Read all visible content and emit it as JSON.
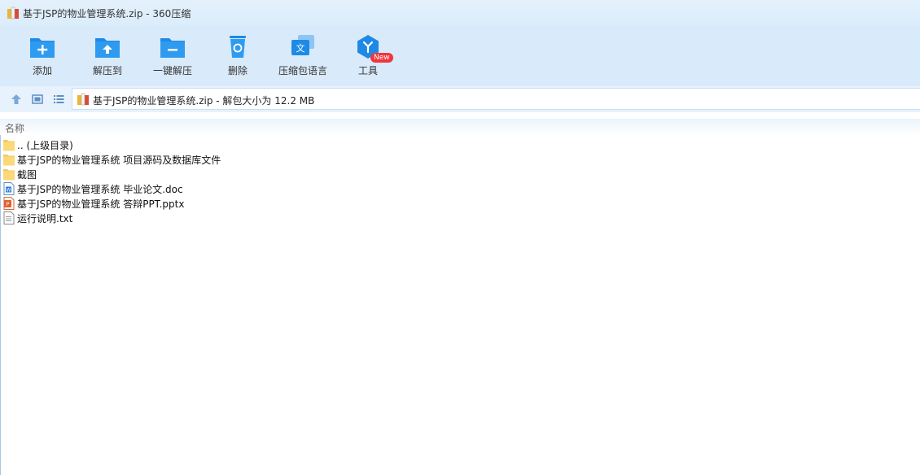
{
  "window": {
    "title": "基于JSP的物业管理系统.zip - 360压缩"
  },
  "toolbar": {
    "buttons": [
      {
        "label": "添加",
        "icon": "add-folder-icon"
      },
      {
        "label": "解压到",
        "icon": "extract-to-icon"
      },
      {
        "label": "一键解压",
        "icon": "one-click-extract-icon"
      },
      {
        "label": "删除",
        "icon": "trash-icon"
      },
      {
        "label": "压缩包语言",
        "icon": "language-icon"
      },
      {
        "label": "工具",
        "icon": "tools-icon"
      }
    ],
    "new_badge": "New"
  },
  "nav": {
    "path": "基于JSP的物业管理系统.zip - 解包大小为 12.2 MB"
  },
  "list": {
    "column_name": "名称",
    "items": [
      {
        "name": ".. (上级目录)",
        "type": "folder"
      },
      {
        "name": "基于JSP的物业管理系统 项目源码及数据库文件",
        "type": "folder"
      },
      {
        "name": "截图",
        "type": "folder"
      },
      {
        "name": "基于JSP的物业管理系统 毕业论文.doc",
        "type": "doc"
      },
      {
        "name": "基于JSP的物业管理系统 答辩PPT.pptx",
        "type": "pptx"
      },
      {
        "name": "运行说明.txt",
        "type": "txt"
      }
    ]
  },
  "colors": {
    "accent": "#1e8ae6",
    "toolbar_bg": "#d9eafa",
    "badge": "#f0353b"
  }
}
